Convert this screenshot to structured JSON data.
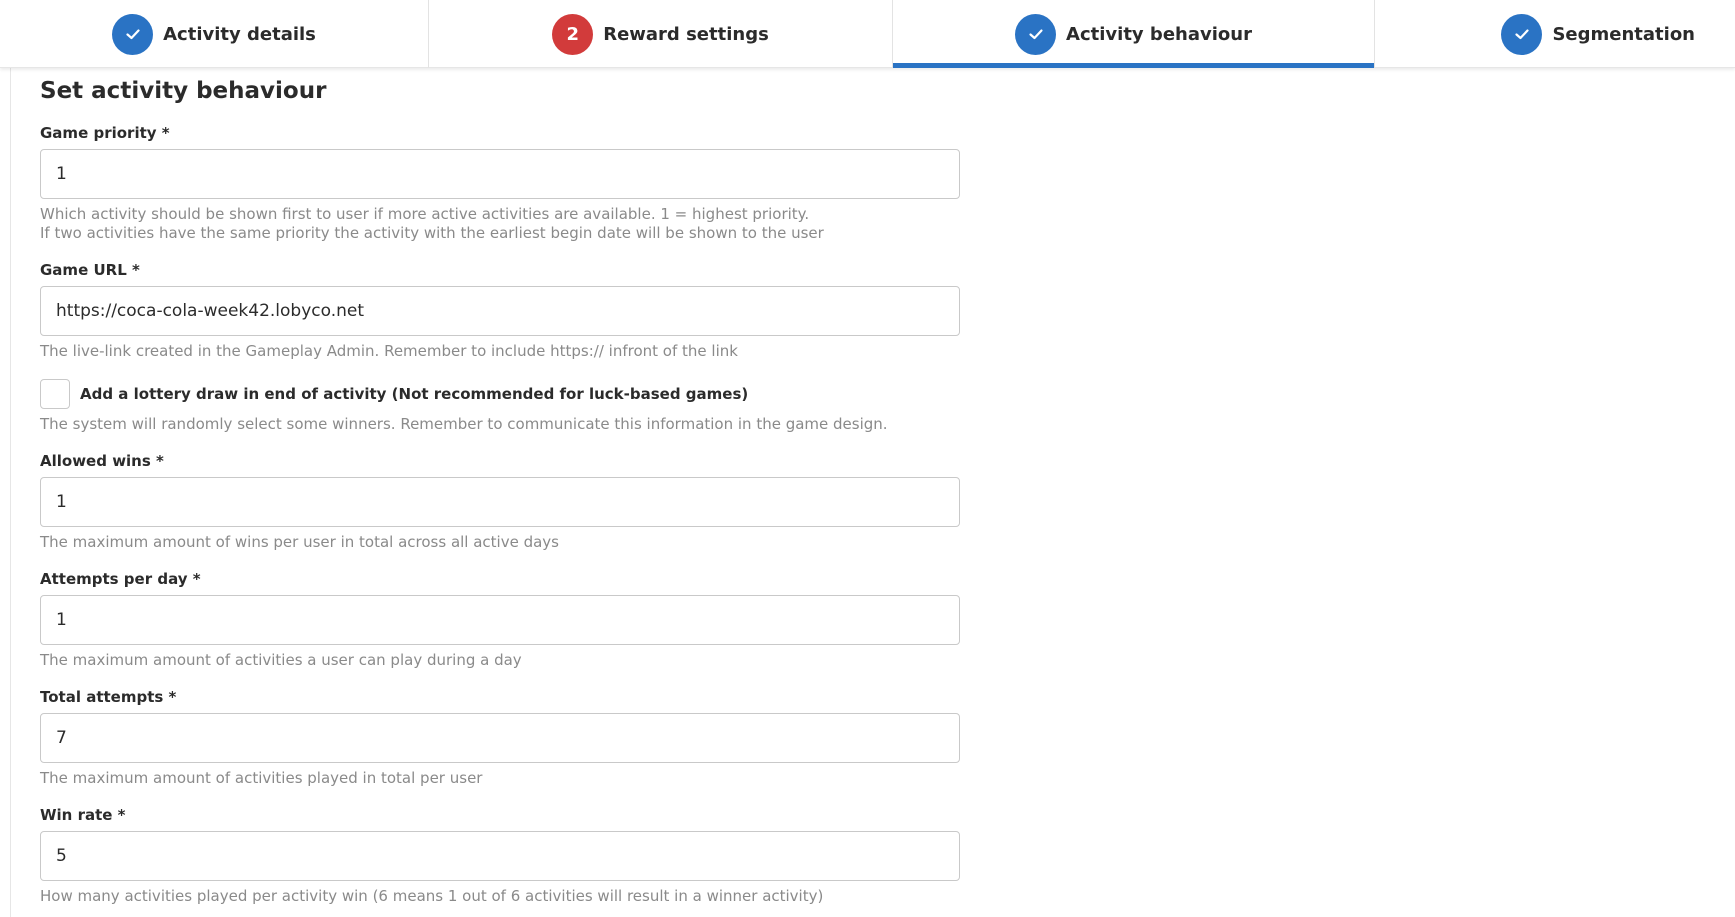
{
  "steps": [
    {
      "label": "Activity details",
      "status": "done",
      "badge": ""
    },
    {
      "label": "Reward settings",
      "status": "error",
      "badge": "2"
    },
    {
      "label": "Activity behaviour",
      "status": "done",
      "badge": "",
      "active": true
    },
    {
      "label": "Segmentation",
      "status": "done",
      "badge": ""
    }
  ],
  "colors": {
    "accent": "#2a73c4",
    "error": "#d23b3b",
    "help_text": "#8a8a8a"
  },
  "form": {
    "title": "Set activity behaviour",
    "game_priority": {
      "label": "Game priority *",
      "value": "1",
      "help_line1": "Which activity should be shown first to user if more active activities are available. 1 = highest priority.",
      "help_line2": "If two activities have the same priority the activity with the earliest begin date will be shown to the user"
    },
    "game_url": {
      "label": "Game URL *",
      "value": "https://coca-cola-week42.lobyco.net",
      "help": "The live-link created in the Gameplay Admin. Remember to include https:// infront of the link"
    },
    "lottery": {
      "label": "Add a lottery draw in end of activity (Not recommended for luck-based games)",
      "checked": false,
      "help": "The system will randomly select some winners. Remember to communicate this information in the game design."
    },
    "allowed_wins": {
      "label": "Allowed wins *",
      "value": "1",
      "help": "The maximum amount of wins per user in total across all active days"
    },
    "attempts_per_day": {
      "label": "Attempts per day *",
      "value": "1",
      "help": "The maximum amount of activities a user can play during a day"
    },
    "total_attempts": {
      "label": "Total attempts *",
      "value": "7",
      "help": "The maximum amount of activities played in total per user"
    },
    "win_rate": {
      "label": "Win rate *",
      "value": "5",
      "help": "How many activities played per activity win (6 means 1 out of 6 activities will result in a winner activity)"
    }
  }
}
